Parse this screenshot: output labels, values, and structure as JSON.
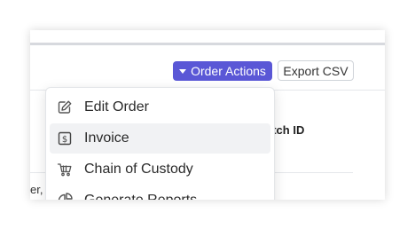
{
  "toolbar": {
    "order_actions_label": "Order Actions",
    "export_csv_label": "Export CSV"
  },
  "table": {
    "column_header": "atch ID",
    "cell_text": "er,"
  },
  "menu": {
    "items": [
      {
        "label": "Edit Order",
        "icon": "edit-icon"
      },
      {
        "label": "Invoice",
        "icon": "invoice-icon"
      },
      {
        "label": "Chain of Custody",
        "icon": "cart-icon"
      },
      {
        "label": "Generate Reports",
        "icon": "pie-chart-icon"
      }
    ]
  },
  "colors": {
    "accent": "#5a57d6",
    "menu_hover": "#f1f2f4"
  }
}
